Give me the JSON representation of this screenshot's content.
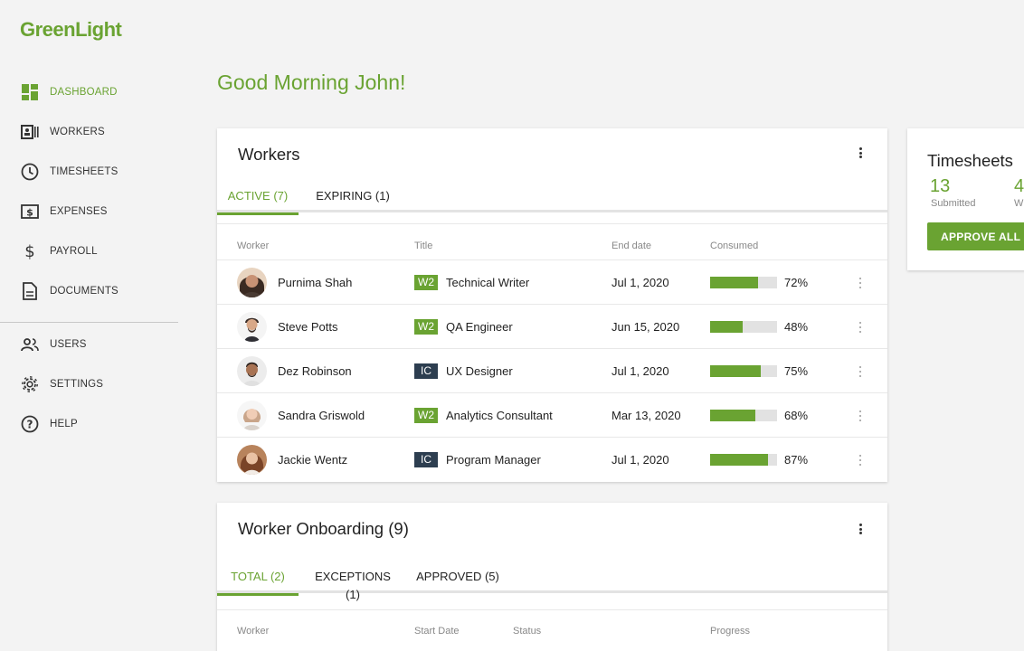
{
  "app": {
    "logo": "GreenLight",
    "brand_color": "#6aa332"
  },
  "sidebar": {
    "items": [
      {
        "label": "DASHBOARD",
        "icon": "dashboard-icon",
        "active": true
      },
      {
        "label": "WORKERS",
        "icon": "id-card-icon"
      },
      {
        "label": "TIMESHEETS",
        "icon": "clock-icon"
      },
      {
        "label": "EXPENSES",
        "icon": "dollar-box-icon"
      },
      {
        "label": "PAYROLL",
        "icon": "dollar-icon"
      },
      {
        "label": "DOCUMENTS",
        "icon": "document-icon"
      }
    ],
    "secondary": [
      {
        "label": "USERS",
        "icon": "users-icon"
      },
      {
        "label": "SETTINGS",
        "icon": "gear-icon"
      },
      {
        "label": "HELP",
        "icon": "help-icon"
      }
    ]
  },
  "greeting": "Good Morning John!",
  "workers_card": {
    "title": "Workers",
    "tabs": [
      {
        "label": "ACTIVE (7)",
        "active": true
      },
      {
        "label": "EXPIRING (1)"
      }
    ],
    "columns": [
      "Worker",
      "Title",
      "End date",
      "Consumed"
    ],
    "rows": [
      {
        "name": "Purnima Shah",
        "type": "W2",
        "title": "Technical Writer",
        "end": "Jul 1, 2020",
        "consumed": 72,
        "consumed_label": "72%"
      },
      {
        "name": "Steve Potts",
        "type": "W2",
        "title": "QA Engineer",
        "end": "Jun 15, 2020",
        "consumed": 48,
        "consumed_label": "48%"
      },
      {
        "name": "Dez Robinson",
        "type": "IC",
        "title": "UX Designer",
        "end": "Jul 1, 2020",
        "consumed": 75,
        "consumed_label": "75%"
      },
      {
        "name": "Sandra Griswold",
        "type": "W2",
        "title": "Analytics Consultant",
        "end": "Mar 13, 2020",
        "consumed": 68,
        "consumed_label": "68%"
      },
      {
        "name": "Jackie Wentz",
        "type": "IC",
        "title": "Program Manager",
        "end": "Jul 1, 2020",
        "consumed": 87,
        "consumed_label": "87%"
      }
    ]
  },
  "onboarding_card": {
    "title": "Worker Onboarding (9)",
    "tabs": [
      {
        "label": "TOTAL (2)",
        "active": true
      },
      {
        "label": "EXCEPTIONS (1)"
      },
      {
        "label": "APPROVED (5)"
      }
    ],
    "columns": [
      "Worker",
      "Start Date",
      "Status",
      "Progress"
    ]
  },
  "timesheets_card": {
    "title": "Timesheets",
    "stats": [
      {
        "value": "13",
        "label": "Submitted"
      },
      {
        "value": "4",
        "label": "W"
      }
    ],
    "approve_label": "APPROVE ALL"
  }
}
